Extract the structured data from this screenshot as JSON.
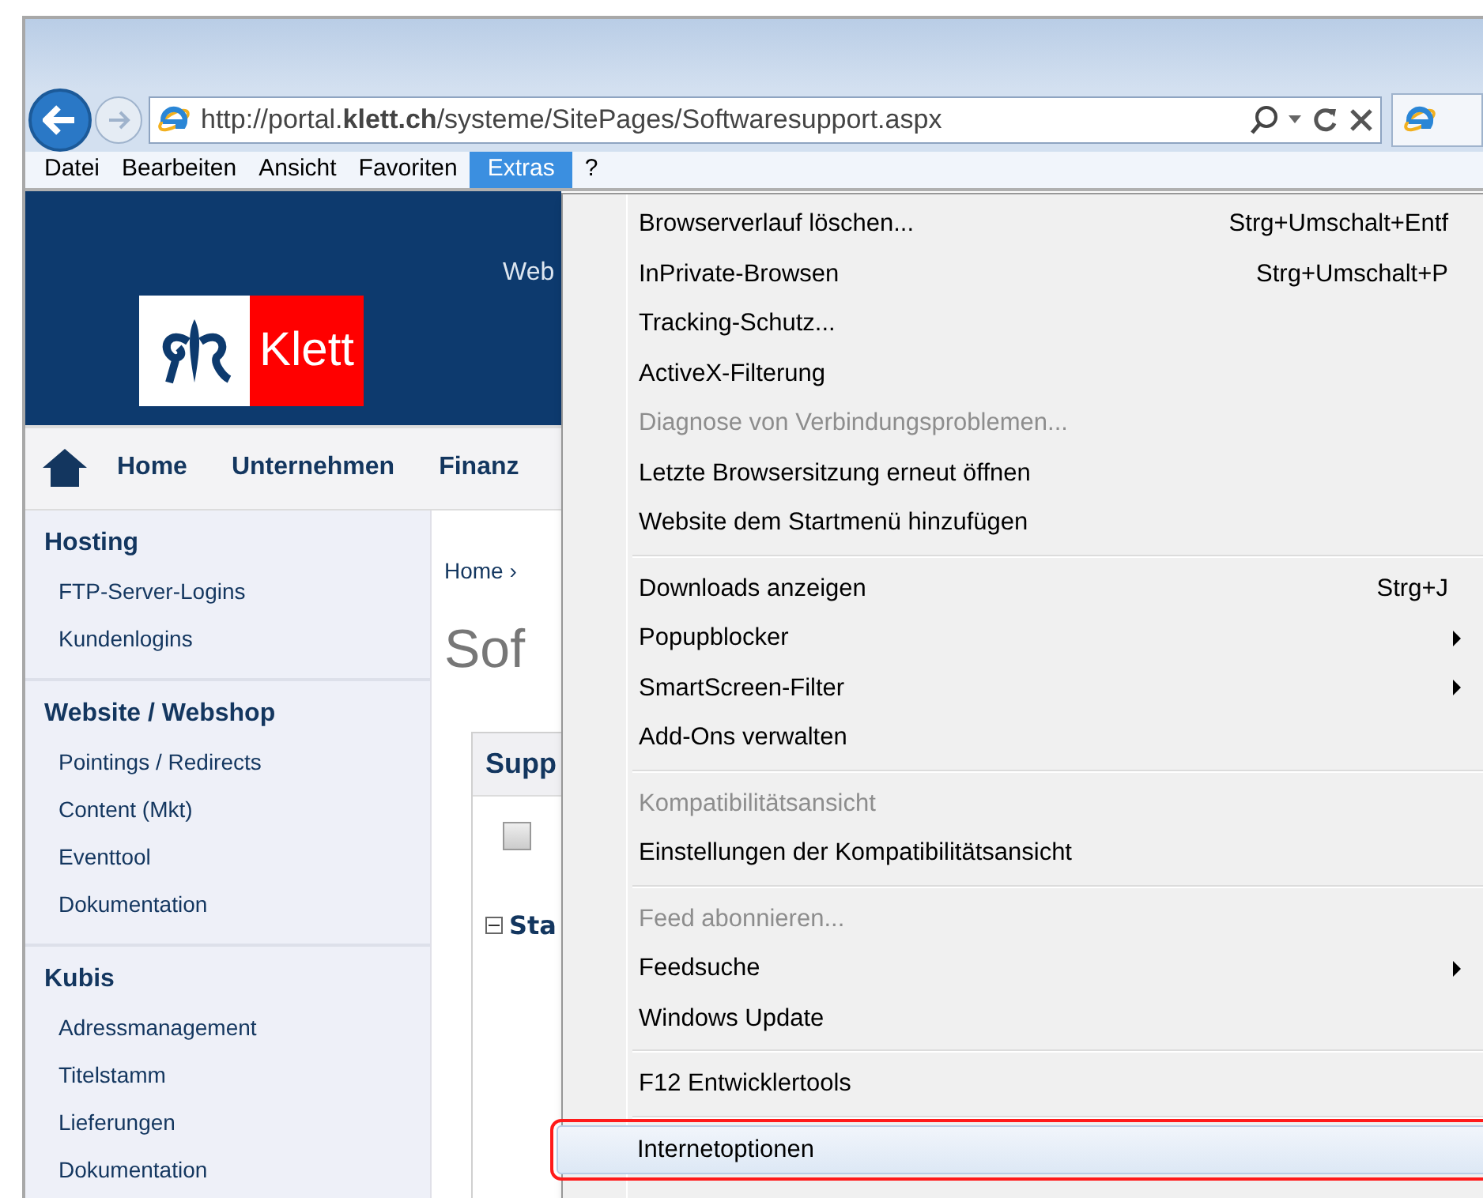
{
  "browser": {
    "url": "http://portal.**klett.ch**/systeme/SitePages/Softwaresupport.aspx"
  },
  "menu_bar": [
    {
      "label": "Datei",
      "selected": false
    },
    {
      "label": "Bearbeiten",
      "selected": false
    },
    {
      "label": "Ansicht",
      "selected": false
    },
    {
      "label": "Favoriten",
      "selected": false
    },
    {
      "label": "Extras",
      "selected": true
    },
    {
      "label": "?",
      "selected": false
    }
  ],
  "page": {
    "header_text": "Web",
    "logo_text": "Klett",
    "nav": [
      "Home",
      "Unternehmen",
      "Finanz"
    ],
    "sidebar": [
      {
        "title": "Hosting",
        "items": [
          "FTP-Server-Logins",
          "Kundenlogins"
        ]
      },
      {
        "title": "Website / Webshop",
        "items": [
          "Pointings / Redirects",
          "Content (Mkt)",
          "Eventtool",
          "Dokumentation"
        ]
      },
      {
        "title": "Kubis",
        "items": [
          "Adressmanagement",
          "Titelstamm",
          "Lieferungen",
          "Dokumentation"
        ]
      }
    ],
    "breadcrumb": "Home ›",
    "title": "Sof",
    "panel_title": "Supp",
    "checkbox": {
      "checked": false
    },
    "section": {
      "label": "Sta",
      "expanded": true
    }
  },
  "extras_menu": [
    {
      "kind": "item",
      "label": "Browserverlauf löschen...",
      "shortcut": "Strg+Umschalt+Entf",
      "disabled": false,
      "submenu": false,
      "selected": false
    },
    {
      "kind": "item",
      "label": "InPrivate-Browsen",
      "shortcut": "Strg+Umschalt+P",
      "disabled": false,
      "submenu": false,
      "selected": false
    },
    {
      "kind": "item",
      "label": "Tracking-Schutz...",
      "disabled": false,
      "submenu": false,
      "selected": false
    },
    {
      "kind": "item",
      "label": "ActiveX-Filterung",
      "disabled": false,
      "submenu": false,
      "selected": false
    },
    {
      "kind": "item",
      "label": "Diagnose von Verbindungsproblemen...",
      "disabled": true,
      "submenu": false,
      "selected": false
    },
    {
      "kind": "item",
      "label": "Letzte Browsersitzung erneut öffnen",
      "disabled": false,
      "submenu": false,
      "selected": false
    },
    {
      "kind": "item",
      "label": "Website dem Startmenü hinzufügen",
      "disabled": false,
      "submenu": false,
      "selected": false
    },
    {
      "kind": "separator"
    },
    {
      "kind": "item",
      "label": "Downloads anzeigen",
      "shortcut": "Strg+J",
      "disabled": false,
      "submenu": false,
      "selected": false
    },
    {
      "kind": "item",
      "label": "Popupblocker",
      "disabled": false,
      "submenu": true,
      "selected": false
    },
    {
      "kind": "item",
      "label": "SmartScreen-Filter",
      "disabled": false,
      "submenu": true,
      "selected": false
    },
    {
      "kind": "item",
      "label": "Add-Ons verwalten",
      "disabled": false,
      "submenu": false,
      "selected": false
    },
    {
      "kind": "separator"
    },
    {
      "kind": "item",
      "label": "Kompatibilitätsansicht",
      "disabled": true,
      "submenu": false,
      "selected": false
    },
    {
      "kind": "item",
      "label": "Einstellungen der Kompatibilitätsansicht",
      "disabled": false,
      "submenu": false,
      "selected": false
    },
    {
      "kind": "separator"
    },
    {
      "kind": "item",
      "label": "Feed abonnieren...",
      "disabled": true,
      "submenu": false,
      "selected": false
    },
    {
      "kind": "item",
      "label": "Feedsuche",
      "disabled": false,
      "submenu": true,
      "selected": false
    },
    {
      "kind": "item",
      "label": "Windows Update",
      "disabled": false,
      "submenu": false,
      "selected": false
    },
    {
      "kind": "separator"
    },
    {
      "kind": "item",
      "label": "F12 Entwicklertools",
      "disabled": false,
      "submenu": false,
      "selected": false
    },
    {
      "kind": "separator"
    },
    {
      "kind": "item",
      "label": "Internetoptionen",
      "disabled": false,
      "submenu": false,
      "selected": true
    }
  ]
}
